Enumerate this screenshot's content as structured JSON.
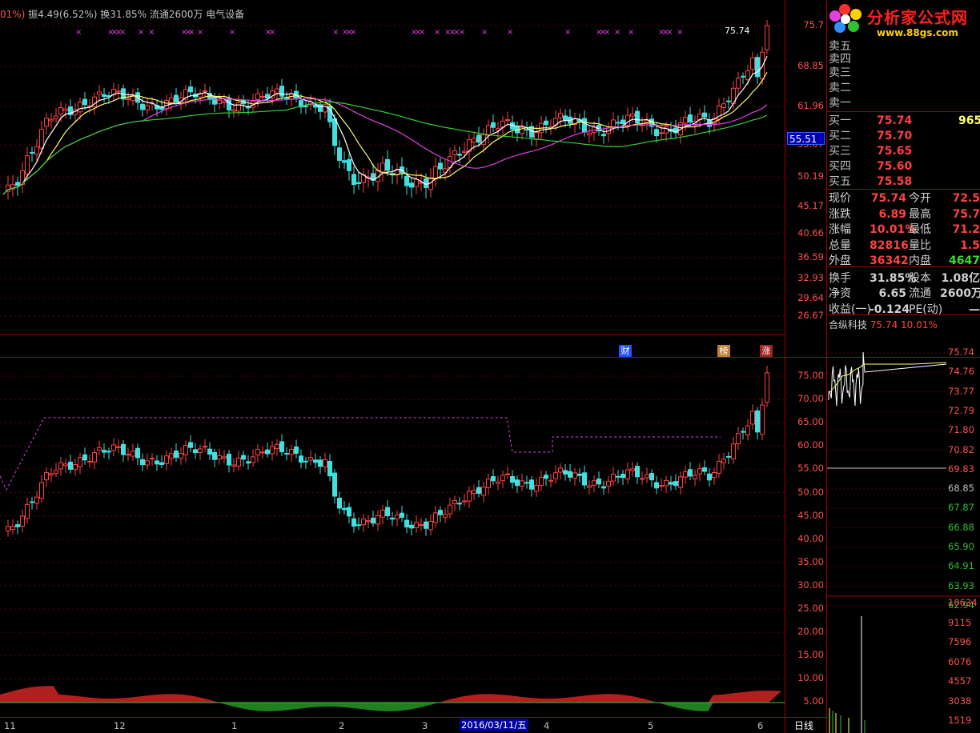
{
  "top_bar": {
    "prefix": "01%)",
    "amp_label": "振4.49",
    "amp_pct": "(6.52%)",
    "turnover": "换31.85%",
    "float": "流通2600万",
    "sector": "电气设备",
    "last_price_marker": "75.74"
  },
  "logo": {
    "text_cn": "分析家公式网",
    "url": "www.88gs.com",
    "brand_colors": [
      "#ff3030",
      "#ffd000",
      "#3090ff",
      "#30c030",
      "#e040e0"
    ]
  },
  "price_axis": [
    "75.7",
    "68.85",
    "61.96",
    "55.07",
    "50.19",
    "45.17",
    "40.66",
    "36.59",
    "32.93",
    "29.64",
    "26.67"
  ],
  "price_tag": "55.51",
  "sub_axis": [
    "75.00",
    "70.00",
    "65.00",
    "60.00",
    "55.00",
    "50.00",
    "45.00",
    "40.00",
    "35.00",
    "30.00",
    "25.00",
    "20.00",
    "15.00",
    "10.00",
    "5.00"
  ],
  "event_tags": [
    {
      "label": "财",
      "color": "#2050ff"
    },
    {
      "label": "榜",
      "color": "#c08030"
    },
    {
      "label": "涨",
      "color": "#a02020"
    }
  ],
  "date_axis": {
    "labels": [
      "11",
      "12",
      "1",
      "2",
      "3",
      "4",
      "5",
      "6"
    ],
    "cursor_date": "2016/03/11/五",
    "period": "日线"
  },
  "orderbook": {
    "sell": [
      {
        "label": "卖五",
        "value": ""
      },
      {
        "label": "卖四",
        "value": ""
      },
      {
        "label": "卖三",
        "value": ""
      },
      {
        "label": "卖二",
        "value": ""
      },
      {
        "label": "卖一",
        "value": ""
      }
    ],
    "buy": [
      {
        "label": "买一",
        "price": "75.74",
        "vol": "965"
      },
      {
        "label": "买二",
        "price": "75.70",
        "vol": ""
      },
      {
        "label": "买三",
        "price": "75.65",
        "vol": ""
      },
      {
        "label": "买四",
        "price": "75.60",
        "vol": ""
      },
      {
        "label": "买五",
        "price": "75.58",
        "vol": ""
      }
    ]
  },
  "quote": {
    "rows": [
      {
        "l1": "现价",
        "v1": "75.74",
        "c1": "red",
        "l2": "今开",
        "v2": "72.5",
        "c2": "red"
      },
      {
        "l1": "涨跌",
        "v1": "6.89",
        "c1": "red",
        "l2": "最高",
        "v2": "75.7",
        "c2": "red"
      },
      {
        "l1": "涨幅",
        "v1": "10.01%",
        "c1": "red",
        "l2": "最低",
        "v2": "71.2",
        "c2": "red"
      },
      {
        "l1": "总量",
        "v1": "82816",
        "c1": "red",
        "l2": "量比",
        "v2": "1.5",
        "c2": "red"
      },
      {
        "l1": "外盘",
        "v1": "36342",
        "c1": "red",
        "l2": "内盘",
        "v2": "4647",
        "c2": "grn"
      },
      {
        "l1": "换手",
        "v1": "31.85%",
        "c1": "wht",
        "l2": "股本",
        "v2": "1.08亿",
        "c2": "wht"
      },
      {
        "l1": "净资",
        "v1": "6.65",
        "c1": "wht",
        "l2": "流通",
        "v2": "2600万",
        "c2": "wht"
      },
      {
        "l1": "收益(一)",
        "v1": "-0.124",
        "c1": "wht",
        "l2": "PE(动)",
        "v2": "—",
        "c2": "wht"
      }
    ]
  },
  "mini_chart": {
    "name": "合纵科技",
    "price": "75.74",
    "pct": "10.01%",
    "price_axis": [
      "75.74",
      "74.76",
      "73.77",
      "72.79",
      "71.80",
      "70.82",
      "69.83",
      "68.85",
      "67.87",
      "66.88",
      "65.90",
      "64.91",
      "63.93",
      "62.94"
    ],
    "vol_axis": [
      "10634",
      "9115",
      "7596",
      "6076",
      "4557",
      "3038",
      "1519"
    ]
  },
  "colors": {
    "up": "#ff4040",
    "down": "#40e0e0",
    "ma_white": "#ffffff",
    "ma_yellow": "#ffff60",
    "ma_magenta": "#e040e0",
    "ma_green": "#30d030",
    "grid": "#800000"
  }
}
